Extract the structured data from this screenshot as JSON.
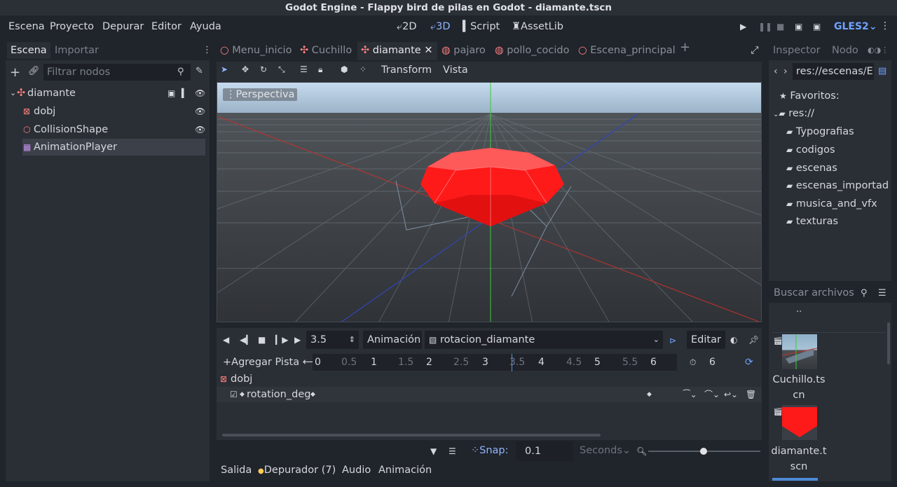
{
  "window": {
    "title": "Godot Engine - Flappy bird de pilas en Godot - diamante.tscn"
  },
  "menu": {
    "items": [
      "Escena",
      "Proyecto",
      "Depurar",
      "Editor",
      "Ayuda"
    ]
  },
  "workspaces": {
    "2d": "2D",
    "3d": "3D",
    "script": "Script",
    "assetlib": "AssetLib"
  },
  "renderer": "GLES2",
  "scene_dock": {
    "tabs": [
      "Escena",
      "Importar"
    ],
    "filter_placeholder": "Filtrar nodos",
    "nodes": [
      {
        "name": "diamante",
        "icon": "spatial-icon"
      },
      {
        "name": "dobj",
        "icon": "mesh-icon"
      },
      {
        "name": "CollisionShape",
        "icon": "collision-shape-icon"
      },
      {
        "name": "AnimationPlayer",
        "icon": "animation-player-icon"
      }
    ]
  },
  "scene_tabs": [
    "Menu_inicio",
    "Cuchillo",
    "diamante",
    "pajaro",
    "pollo_cocido",
    "Escena_principal"
  ],
  "viewport_toolbar": {
    "transform": "Transform",
    "view": "Vista"
  },
  "viewport": {
    "label": "Perspectiva"
  },
  "animation": {
    "time": "3.5",
    "animation_menu": "Animación",
    "current": "rotacion_diamante",
    "edit": "Editar",
    "add_track": "Agregar Pista",
    "length": "6",
    "ticks": [
      "0",
      "0.5",
      "1",
      "1.5",
      "2",
      "2.5",
      "3",
      "3.5",
      "4",
      "4.5",
      "5",
      "5.5",
      "6"
    ],
    "track_node": "dobj",
    "track_property": "rotation_deg",
    "snap_label": "Snap:",
    "snap_value": "0.1",
    "snap_unit": "Seconds"
  },
  "bottom_tabs": {
    "output": "Salida",
    "debugger": "Depurador (7)",
    "audio": "Audio",
    "animation": "Animación"
  },
  "inspector_dock": {
    "tabs": [
      "Inspector",
      "Nodo"
    ],
    "path": "res://escenas/E",
    "favorites": "Favoritos:",
    "root": "res://",
    "folders": [
      "Typografias",
      "codigos",
      "escenas",
      "escenas_importad",
      "musica_and_vfx",
      "texturas"
    ],
    "search_placeholder": "Buscar archivos",
    "parent": "..",
    "files": [
      {
        "name_line1": "Cuchillo.ts",
        "name_line2": "cn"
      },
      {
        "name_line1": "diamante.t",
        "name_line2": "scn"
      }
    ]
  },
  "colors": {
    "accent": "#6fa3ff",
    "background": "#20242b",
    "panel": "#2a2e35",
    "gem": "#ff1a1a"
  }
}
